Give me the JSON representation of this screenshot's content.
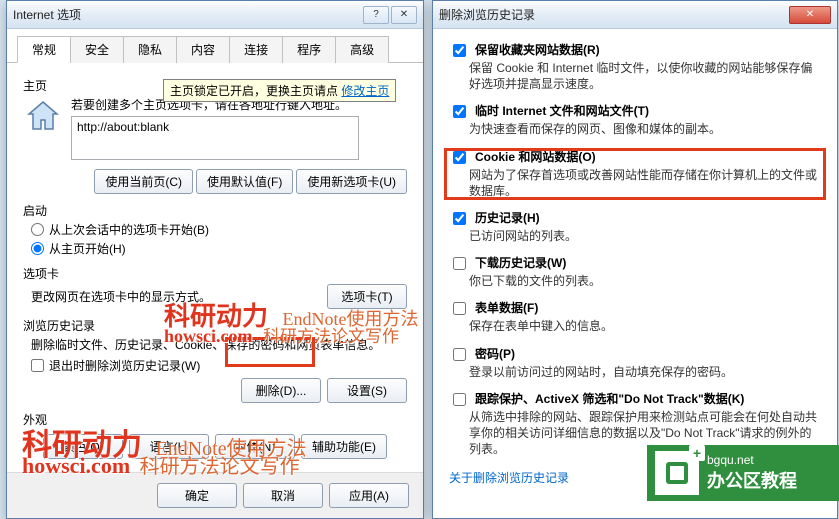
{
  "left_window": {
    "title": "Internet 选项",
    "tabs": [
      "常规",
      "安全",
      "隐私",
      "内容",
      "连接",
      "程序",
      "高级"
    ],
    "active_tab": 0,
    "homepage": {
      "group_label": "主页",
      "hint": "若要创建多个主页选项卡，请在各地址行键入地址。",
      "tooltip_prefix": "主页锁定已开启，更换主页请点 ",
      "tooltip_link": "修改主页",
      "url_value": "http://about:blank",
      "btn_current": "使用当前页(C)",
      "btn_default": "使用默认值(F)",
      "btn_newtab": "使用新选项卡(U)"
    },
    "startup": {
      "group_label": "启动",
      "opt_last": "从上次会话中的选项卡开始(B)",
      "opt_home": "从主页开始(H)",
      "selected": "opt_home"
    },
    "tabs_section": {
      "group_label": "选项卡",
      "desc": "更改网页在选项卡中的显示方式。",
      "btn": "选项卡(T)"
    },
    "history": {
      "group_label": "浏览历史记录",
      "desc": "删除临时文件、历史记录、Cookie、保存的密码和网页表单信息。",
      "chk_exit": "退出时删除浏览历史记录(W)",
      "btn_delete": "删除(D)...",
      "btn_settings": "设置(S)"
    },
    "appearance": {
      "group_label": "外观",
      "btn_colors": "颜色(O)",
      "btn_lang": "语言(L)",
      "btn_fonts": "字体(N)",
      "btn_access": "辅助功能(E)"
    },
    "footer": {
      "ok": "确定",
      "cancel": "取消",
      "apply": "应用(A)"
    }
  },
  "right_window": {
    "title": "删除浏览历史记录",
    "items": [
      {
        "checked": true,
        "label": "保留收藏夹网站数据(R)",
        "desc": "保留 Cookie 和 Internet 临时文件，以使你收藏的网站能够保存偏好选项并提高显示速度。"
      },
      {
        "checked": true,
        "label": "临时 Internet 文件和网站文件(T)",
        "desc": "为快速查看而保存的网页、图像和媒体的副本。"
      },
      {
        "checked": true,
        "label": "Cookie 和网站数据(O)",
        "desc": "网站为了保存首选项或改善网站性能而存储在你计算机上的文件或数据库。"
      },
      {
        "checked": true,
        "label": "历史记录(H)",
        "desc": "已访问网站的列表。"
      },
      {
        "checked": false,
        "label": "下载历史记录(W)",
        "desc": "你已下载的文件的列表。"
      },
      {
        "checked": false,
        "label": "表单数据(F)",
        "desc": "保存在表单中键入的信息。"
      },
      {
        "checked": false,
        "label": "密码(P)",
        "desc": "登录以前访问过的网站时，自动填充保存的密码。"
      },
      {
        "checked": false,
        "label": "跟踪保护、ActiveX 筛选和\"Do Not Track\"数据(K)",
        "desc": "从筛选中排除的网站、跟踪保护用来检测站点可能会在何处自动共享你的相关访问详细信息的数据以及\"Do Not Track\"请求的例外的列表。"
      }
    ],
    "about_link": "关于删除浏览历史记录"
  },
  "watermarks": {
    "brand": "科研动力",
    "brand_en": "howsci.com",
    "line1": "EndNote使用方法",
    "line2": "科研方法论文写作"
  },
  "badge": {
    "top": "bgqu.net",
    "bottom": "办公区教程"
  }
}
